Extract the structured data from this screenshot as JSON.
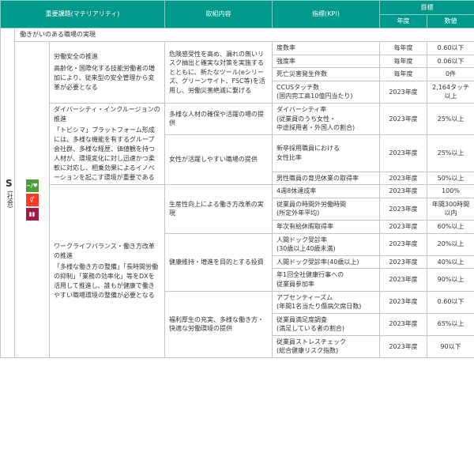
{
  "header": {
    "issue": "重要課題(マテリアリティ)",
    "action": "取組内容",
    "kpi": "指標(KPI)",
    "target": "目標",
    "year": "年度",
    "value": "数値"
  },
  "pillar": {
    "letter": "S",
    "name": "(社会)"
  },
  "section_title": "働きがいのある職場の実現",
  "sdgs": [
    {
      "name": "sdg3-icon",
      "color": "#4c9f38",
      "glyph": "~/♥"
    },
    {
      "name": "sdg5-icon",
      "color": "#ff3a21",
      "glyph": "⚥"
    },
    {
      "name": "sdg8-icon",
      "color": "#a21942",
      "glyph": "▮▮"
    }
  ],
  "themes": [
    {
      "title": "労働安全の推進",
      "desc": "高齢化・国際化する技能労働者の増加により、従来型の安全管理から変革が必要となる",
      "groups": [
        {
          "action": "危険感受性を高め、漏れの無いリスク抽出と確実な対策を実施するとともに、新たなツール(eシリーズ、グリーンサイト、FSC等)を活用し、労働災害絶滅に繋げる",
          "kpis": [
            {
              "kpi": "度数率",
              "year": "毎年度",
              "value": "0.60以下"
            },
            {
              "kpi": "強度率",
              "year": "毎年度",
              "value": "0.06以下"
            },
            {
              "kpi": "死亡災害発生件数",
              "year": "毎年度",
              "value": "0件"
            },
            {
              "kpi": "CCUSタッチ数\n(国内完工高10億円当たり)",
              "year": "2023年度",
              "value": "2,164タッチ\n以上"
            }
          ]
        }
      ]
    },
    {
      "title": "ダイバーシティ・インクルージョンの推進",
      "desc": "「トビシマ」プラットフォーム形成には、多様な機能を有するグループ会社群、多様な経歴、価値観を持つ人材が、環境変化に対し迅速かつ柔軟に対応し、相乗効果によるイノベーションを起こす環境が重要である",
      "groups": [
        {
          "action": "多様な人材の確保や活躍の場の提供",
          "kpis": [
            {
              "kpi": "ダイバーシティ率\n(従業員のうち女性・\n中途採用者・外国人の割合)",
              "year": "2023年度",
              "value": "25%以上"
            }
          ]
        },
        {
          "action": "女性が活躍しやすい職場の提供",
          "kpis": [
            {
              "kpi": "新卒採用職員における\n女性比率",
              "year": "2023年度",
              "value": "25%以上"
            },
            {
              "kpi": "男性職員の育児休業の取得率",
              "year": "2023年度",
              "value": "50%以上"
            }
          ]
        }
      ]
    },
    {
      "title": "ワークライフバランス・働き方改革の推進",
      "desc": "「多様な働き方の整備」「長時間労働の抑制」「業務の効率化」等をDXを活用して推進し、誰もが健康で働きやすい職場環境の整備が必要となる",
      "groups": [
        {
          "action": "生産性向上による働き方改革の実現",
          "kpis": [
            {
              "kpi": "4週8休達成率",
              "year": "2023年度",
              "value": "100%"
            },
            {
              "kpi": "従業員の時間外労働時間\n(所定外年平均)",
              "year": "2023年度",
              "value": "年間300時間\n以内"
            },
            {
              "kpi": "年次有給休暇取得率",
              "year": "2023年度",
              "value": "60%以上"
            }
          ]
        },
        {
          "action": "健康維持・増進を目的とする投資",
          "kpis": [
            {
              "kpi": "人間ドック受診率\n(30歳以上40歳未満)",
              "year": "2023年度",
              "value": "20%以上"
            },
            {
              "kpi": "人間ドック受診率(40歳以上)",
              "year": "2023年度",
              "value": "40%以上"
            },
            {
              "kpi": "年1回全社健康行事への\n従業員参加率",
              "year": "2023年度",
              "value": "90%以上"
            }
          ]
        },
        {
          "action": "福利厚生の充実、多様な働き方・快適な労働環境の提供",
          "kpis": [
            {
              "kpi": "アブセンティーズム\n(年間1名当たり傷病欠席日数)",
              "year": "2023年度",
              "value": "0.60以下"
            },
            {
              "kpi": "従業員満足度調査\n(満足している者の割合)",
              "year": "2023年度",
              "value": "65%以上"
            },
            {
              "kpi": "従業員ストレスチェック\n(総合健康リスク指数)",
              "year": "2023年度",
              "value": "90以下"
            }
          ]
        }
      ]
    }
  ]
}
